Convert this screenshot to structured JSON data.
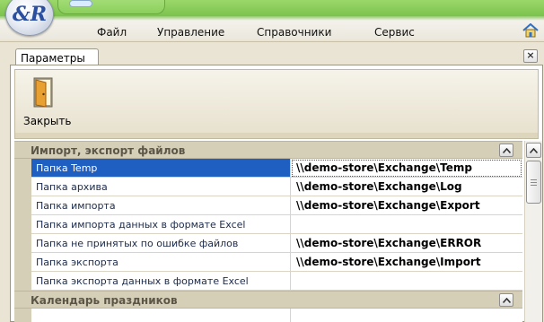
{
  "app": {
    "logo_text": "&R"
  },
  "menu": {
    "items": [
      "Файл",
      "Управление",
      "Справочники",
      "Сервис"
    ]
  },
  "tabs": {
    "active_label": "Параметры",
    "close_glyph": "×"
  },
  "toolbar": {
    "close_label": "Закрыть"
  },
  "groups": [
    {
      "title": "Импорт, экспорт файлов",
      "rows": [
        {
          "name": "Папка Temp",
          "value": "\\\\demo-store\\Exchange\\Temp",
          "selected": true
        },
        {
          "name": "Папка архива",
          "value": "\\\\demo-store\\Exchange\\Log"
        },
        {
          "name": "Папка импорта",
          "value": "\\\\demo-store\\Exchange\\Export"
        },
        {
          "name": "Папка импорта данных в формате Excel",
          "value": ""
        },
        {
          "name": "Папка не принятых по ошибке файлов",
          "value": "\\\\demo-store\\Exchange\\ERROR"
        },
        {
          "name": "Папка экспорта",
          "value": "\\\\demo-store\\Exchange\\Import"
        },
        {
          "name": "Папка экспорта данных в формате Excel",
          "value": ""
        }
      ]
    },
    {
      "title": "Календарь праздников",
      "rows": []
    }
  ],
  "colors": {
    "title_green": "#7cc24e",
    "selection_blue": "#1f5fc2",
    "group_header": "#d6cfb7"
  },
  "icons": [
    "app-logo-icon",
    "home-icon",
    "close-tab-icon",
    "door-exit-icon",
    "collapse-up-icon",
    "scroll-up-icon"
  ]
}
